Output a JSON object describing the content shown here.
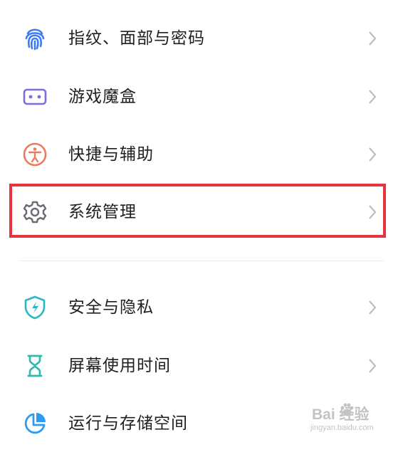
{
  "settings": {
    "items": [
      {
        "label": "指纹、面部与密码",
        "icon": "fingerprint-icon",
        "color": "#3a7bf6"
      },
      {
        "label": "游戏魔盒",
        "icon": "game-box-icon",
        "color": "#7a6fe0"
      },
      {
        "label": "快捷与辅助",
        "icon": "accessibility-icon",
        "color": "#f07a5c"
      },
      {
        "label": "系统管理",
        "icon": "gear-icon",
        "color": "#6b6b73"
      },
      {
        "label": "安全与隐私",
        "icon": "shield-icon",
        "color": "#29b8c4"
      },
      {
        "label": "屏幕使用时间",
        "icon": "hourglass-icon",
        "color": "#2fb8b0"
      },
      {
        "label": "运行与存储空间",
        "icon": "pie-chart-icon",
        "color": "#2d9cf0"
      }
    ]
  },
  "highlight": {
    "color": "#e8323c",
    "target": "系统管理"
  },
  "watermark": {
    "main": "Bai 经验",
    "sub": "jingyan.baidu.com"
  }
}
